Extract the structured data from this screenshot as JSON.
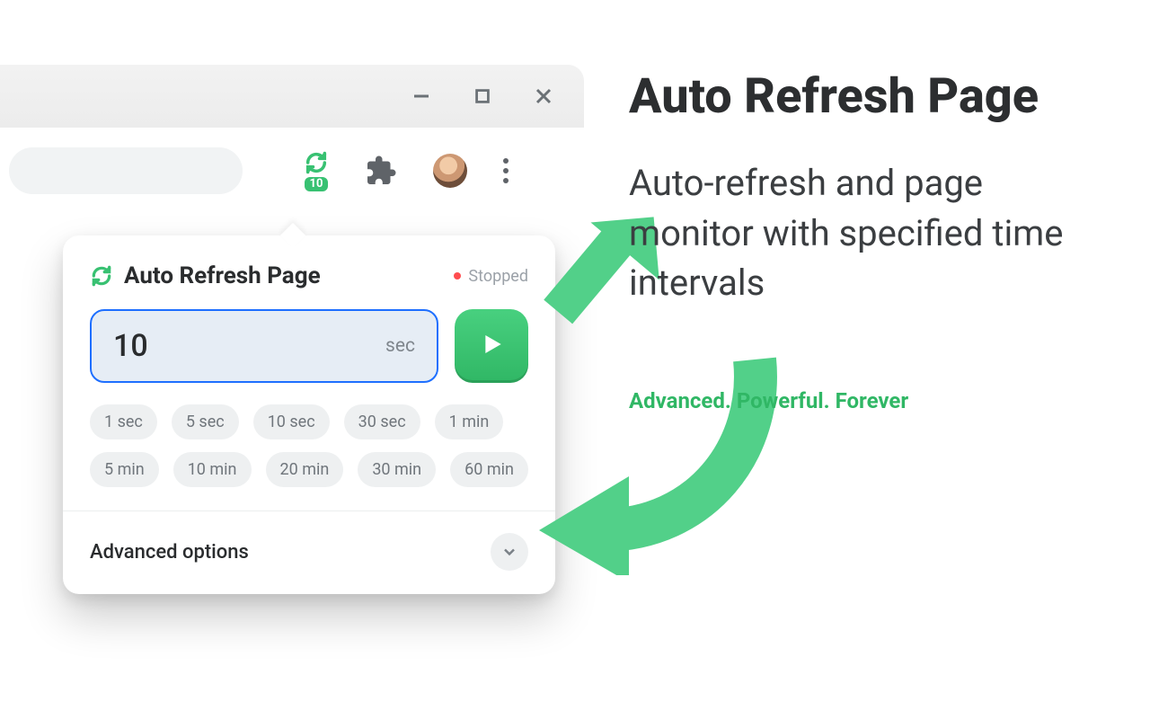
{
  "toolbar": {
    "extension_badge": "10"
  },
  "popup": {
    "title": "Auto Refresh Page",
    "status_label": "Stopped",
    "interval_value": "10",
    "interval_unit": "sec",
    "presets": [
      "1 sec",
      "5 sec",
      "10 sec",
      "30 sec",
      "1 min",
      "5 min",
      "10 min",
      "20 min",
      "30 min",
      "60 min"
    ],
    "advanced_label": "Advanced options"
  },
  "marketing": {
    "title": "Auto Refresh Page",
    "description": "Auto-refresh and page monitor with specified time intervals",
    "tagline": "Advanced. Powerful. Forever"
  }
}
